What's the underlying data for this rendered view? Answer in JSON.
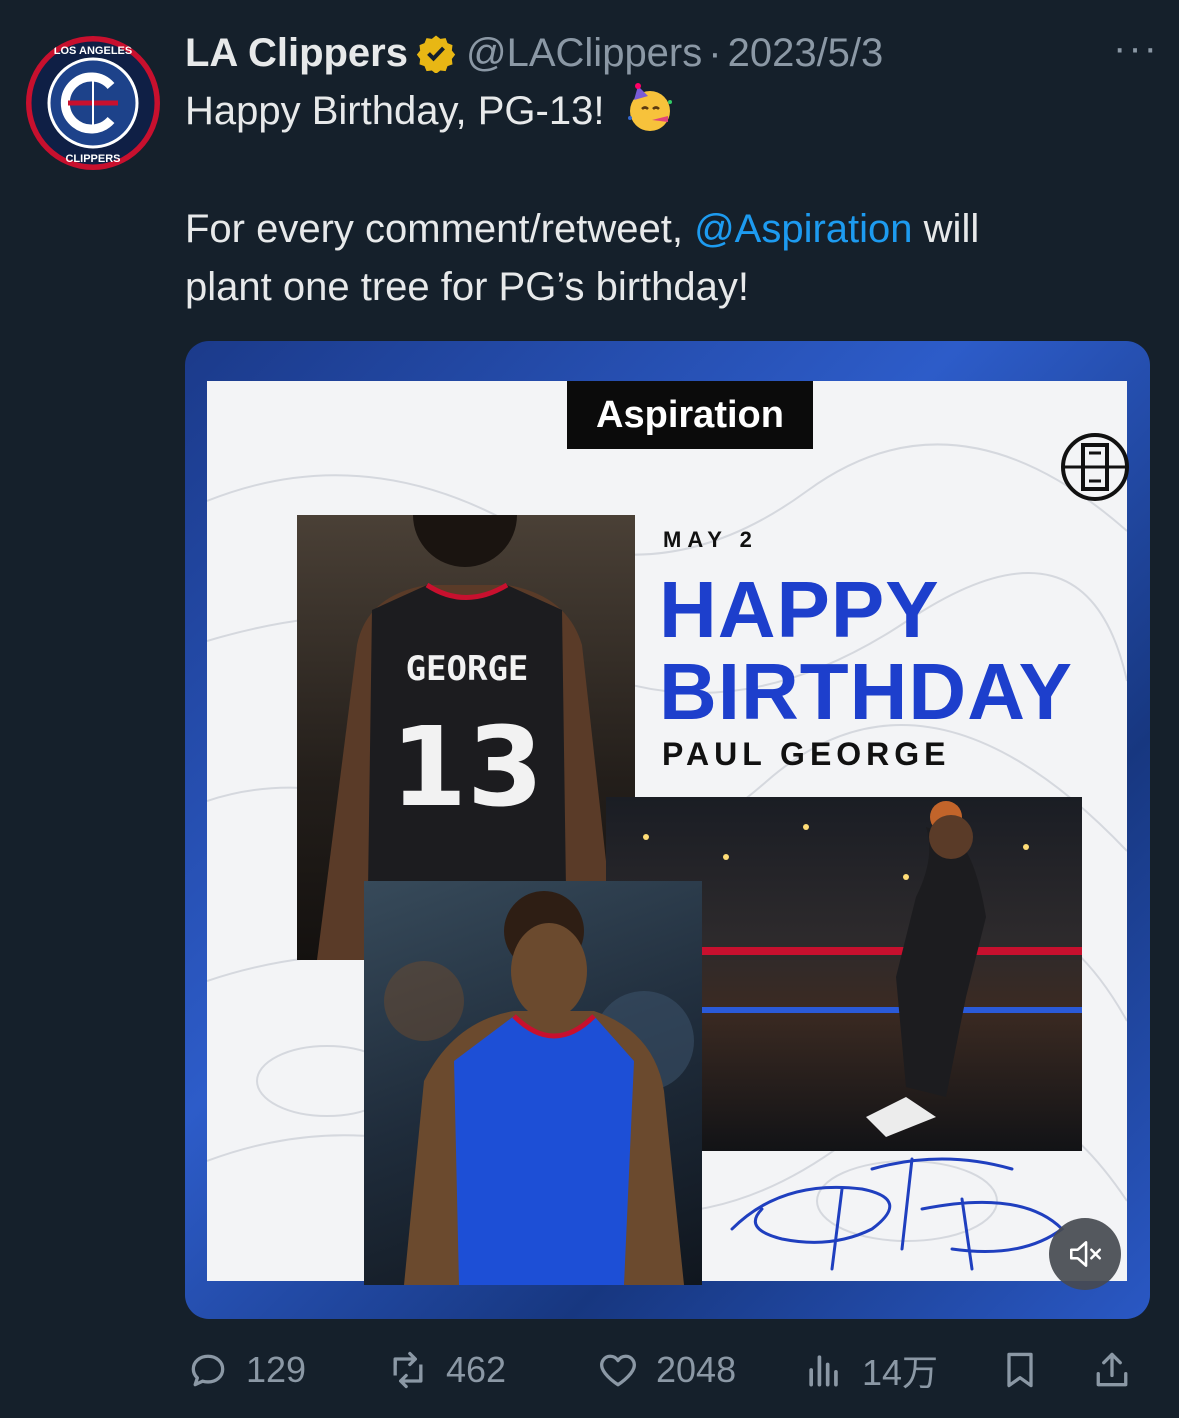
{
  "tweet": {
    "author_name": "LA Clippers",
    "handle": "@LAClippers",
    "separator": "·",
    "date": "2023/5/3",
    "more_label": "···",
    "line1": "Happy Birthday, PG-13!",
    "line2_a": "For every comment/retweet,",
    "line2_mention": "@Aspiration",
    "line2_b": "will",
    "line3": "plant one tree for PG’s birthday!",
    "emoji": "partying-face-emoji",
    "avatar_logo_text_top": "LOS ANGELES",
    "avatar_logo_text_bottom": "CLIPPERS",
    "verified_color": "#e8b714",
    "mention_color": "#1d9bf0"
  },
  "media": {
    "sponsor": "Aspiration",
    "date_label": "MAY 2",
    "headline_1": "HAPPY",
    "headline_2": "BIRTHDAY",
    "player_name": "PAUL GEORGE",
    "jersey_name": "GEORGE",
    "jersey_number": "13",
    "headline_color": "#1d3fcc",
    "mute_icon": "speaker-muted-icon"
  },
  "actions": {
    "replies": "129",
    "retweets": "462",
    "likes": "2048",
    "views": "14万"
  }
}
